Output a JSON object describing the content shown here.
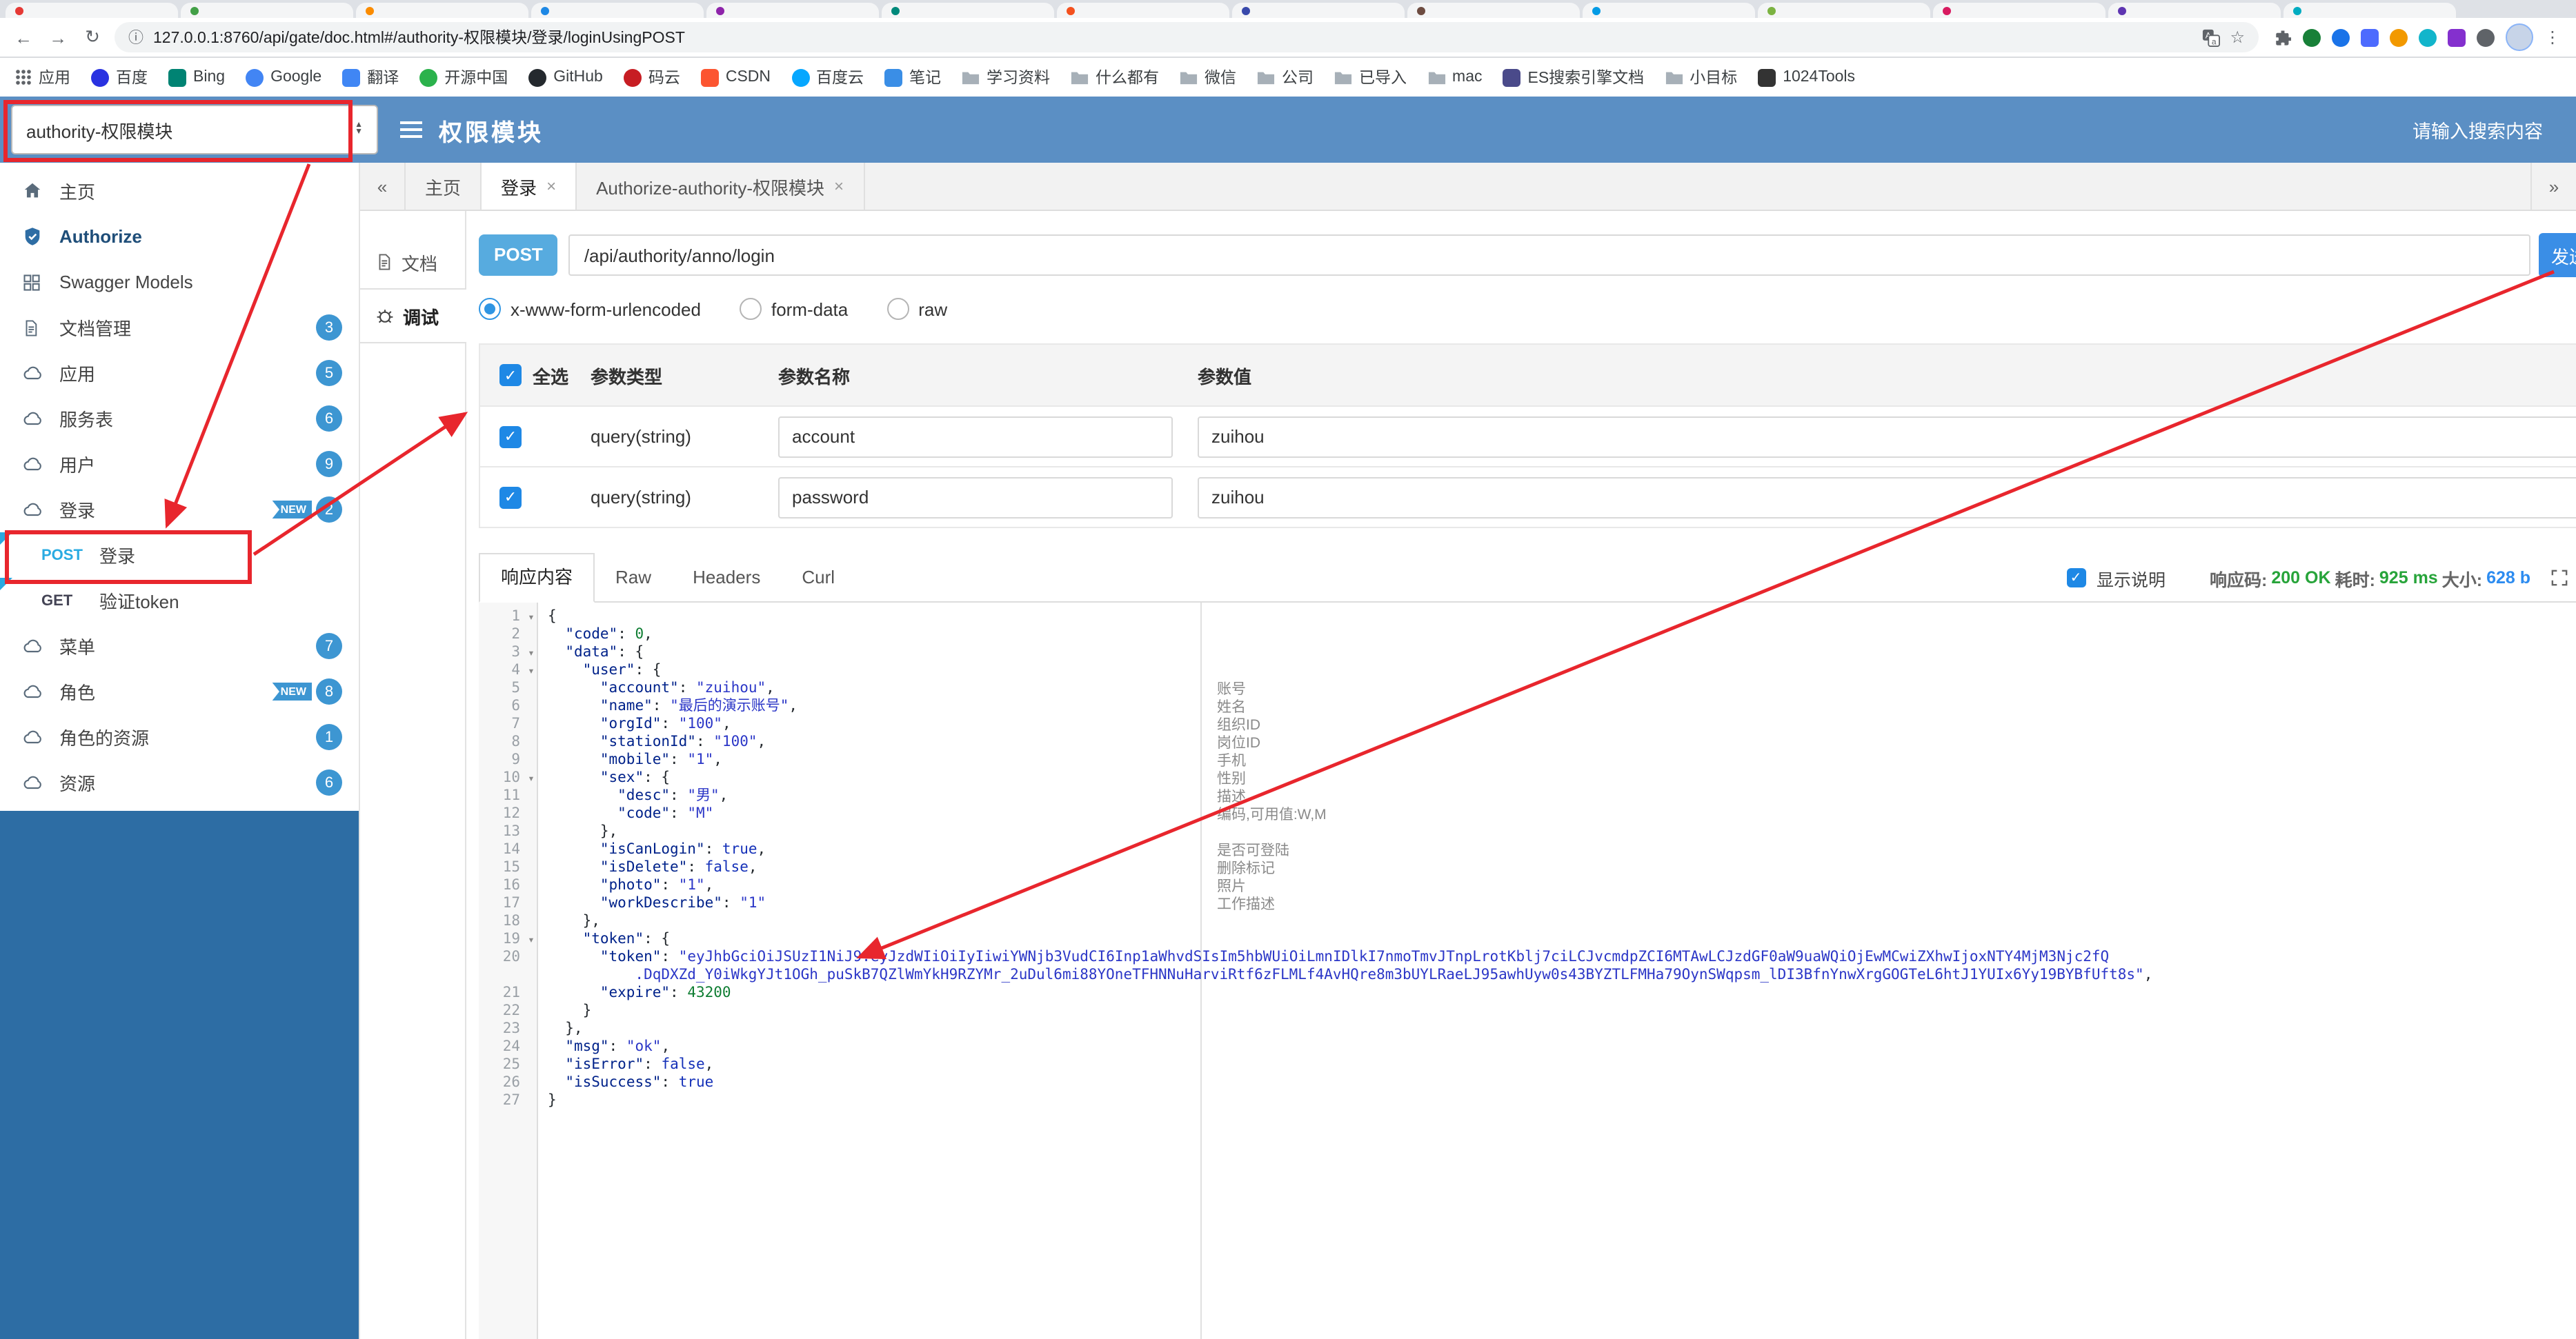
{
  "browser": {
    "url": "127.0.0.1:8760/api/gate/doc.html#/authority-权限模块/登录/loginUsingPOST",
    "bookmarks": [
      {
        "label": "应用",
        "icon": "grid"
      },
      {
        "label": "百度",
        "icon": "dot",
        "color": "#2932e1"
      },
      {
        "label": "Bing",
        "icon": "square",
        "color": "#008373"
      },
      {
        "label": "Google",
        "icon": "dot",
        "color": "#4285f4"
      },
      {
        "label": "翻译",
        "icon": "square",
        "color": "#4086f4"
      },
      {
        "label": "开源中国",
        "icon": "dot",
        "color": "#2bb24c"
      },
      {
        "label": "GitHub",
        "icon": "dot",
        "color": "#24292e"
      },
      {
        "label": "码云",
        "icon": "dot",
        "color": "#c71d23"
      },
      {
        "label": "CSDN",
        "icon": "square",
        "color": "#fc5531"
      },
      {
        "label": "百度云",
        "icon": "dot",
        "color": "#06a7ff"
      },
      {
        "label": "笔记",
        "icon": "square",
        "color": "#3a8ee6"
      },
      {
        "label": "学习资料",
        "icon": "folder"
      },
      {
        "label": "什么都有",
        "icon": "folder"
      },
      {
        "label": "微信",
        "icon": "folder"
      },
      {
        "label": "公司",
        "icon": "folder"
      },
      {
        "label": "已导入",
        "icon": "folder"
      },
      {
        "label": "mac",
        "icon": "folder"
      },
      {
        "label": "ES搜索引擎文档",
        "icon": "square",
        "color": "#4a4a8a"
      },
      {
        "label": "小目标",
        "icon": "folder"
      },
      {
        "label": "1024Tools",
        "icon": "square",
        "color": "#333333"
      }
    ]
  },
  "header": {
    "module_select": "authority-权限模块",
    "title": "权限模块",
    "search_placeholder": "请输入搜索内容"
  },
  "sidebar": {
    "new_label": "NEW",
    "items": [
      {
        "type": "nav",
        "label": "主页",
        "icon": "home"
      },
      {
        "type": "nav",
        "label": "Authorize",
        "icon": "shield"
      },
      {
        "type": "nav",
        "label": "Swagger Models",
        "icon": "models"
      },
      {
        "type": "nav",
        "label": "文档管理",
        "icon": "file",
        "badge": "3"
      },
      {
        "type": "nav",
        "label": "应用",
        "icon": "cloud",
        "badge": "5"
      },
      {
        "type": "nav",
        "label": "服务表",
        "icon": "cloud",
        "badge": "6"
      },
      {
        "type": "nav",
        "label": "用户",
        "icon": "cloud",
        "badge": "9"
      },
      {
        "type": "nav",
        "label": "登录",
        "icon": "cloud",
        "badge": "2",
        "new": true
      },
      {
        "type": "api",
        "method": "POST",
        "label": "登录"
      },
      {
        "type": "api",
        "method": "GET",
        "label": "验证token"
      },
      {
        "type": "nav",
        "label": "菜单",
        "icon": "cloud",
        "badge": "7"
      },
      {
        "type": "nav",
        "label": "角色",
        "icon": "cloud",
        "badge": "8",
        "new": true
      },
      {
        "type": "nav",
        "label": "角色的资源",
        "icon": "cloud",
        "badge": "1"
      },
      {
        "type": "nav",
        "label": "资源",
        "icon": "cloud",
        "badge": "6"
      }
    ]
  },
  "tabs": [
    {
      "label": "主页",
      "closable": false,
      "active": false
    },
    {
      "label": "登录",
      "closable": true,
      "active": true
    },
    {
      "label": "Authorize-authority-权限模块",
      "closable": true,
      "active": false
    }
  ],
  "panel": {
    "doc": "文档",
    "debug": "调试"
  },
  "endpoint": {
    "method": "POST",
    "path": "/api/authority/anno/login",
    "send_label": "发送"
  },
  "request": {
    "content_types": [
      "x-www-form-urlencoded",
      "form-data",
      "raw"
    ],
    "selected": "x-www-form-urlencoded",
    "table": {
      "headers": [
        "全选",
        "参数类型",
        "参数名称",
        "参数值"
      ],
      "rows": [
        {
          "checked": true,
          "type": "query(string)",
          "name": "account",
          "value": "zuihou"
        },
        {
          "checked": true,
          "type": "query(string)",
          "name": "password",
          "value": "zuihou"
        }
      ]
    }
  },
  "response": {
    "tabs": [
      "响应内容",
      "Raw",
      "Headers",
      "Curl"
    ],
    "active_tab": "响应内容",
    "desc_label": "显示说明",
    "desc_checked": true,
    "code_label": "响应码:",
    "code_value": "200 OK",
    "time_label": "耗时:",
    "time_value": "925 ms",
    "size_label": "大小:",
    "size_value": "628 b"
  },
  "code": {
    "lines": [
      {
        "n": 1,
        "fold": true,
        "seg": [
          [
            "pun",
            "{"
          ]
        ]
      },
      {
        "n": 2,
        "seg": [
          [
            "pun",
            "  "
          ],
          [
            "key",
            "\"code\""
          ],
          [
            "pun",
            ": "
          ],
          [
            "num",
            "0"
          ],
          [
            "pun",
            ","
          ]
        ]
      },
      {
        "n": 3,
        "fold": true,
        "seg": [
          [
            "pun",
            "  "
          ],
          [
            "key",
            "\"data\""
          ],
          [
            "pun",
            ": {"
          ]
        ]
      },
      {
        "n": 4,
        "fold": true,
        "seg": [
          [
            "pun",
            "    "
          ],
          [
            "key",
            "\"user\""
          ],
          [
            "pun",
            ": {"
          ]
        ]
      },
      {
        "n": 5,
        "ann": "账号",
        "seg": [
          [
            "pun",
            "      "
          ],
          [
            "key",
            "\"account\""
          ],
          [
            "pun",
            ": "
          ],
          [
            "str",
            "\"zuihou\""
          ],
          [
            "pun",
            ","
          ]
        ]
      },
      {
        "n": 6,
        "ann": "姓名",
        "seg": [
          [
            "pun",
            "      "
          ],
          [
            "key",
            "\"name\""
          ],
          [
            "pun",
            ": "
          ],
          [
            "str",
            "\"最后的演示账号\""
          ],
          [
            "pun",
            ","
          ]
        ]
      },
      {
        "n": 7,
        "ann": "组织ID",
        "seg": [
          [
            "pun",
            "      "
          ],
          [
            "key",
            "\"orgId\""
          ],
          [
            "pun",
            ": "
          ],
          [
            "str",
            "\"100\""
          ],
          [
            "pun",
            ","
          ]
        ]
      },
      {
        "n": 8,
        "ann": "岗位ID",
        "seg": [
          [
            "pun",
            "      "
          ],
          [
            "key",
            "\"stationId\""
          ],
          [
            "pun",
            ": "
          ],
          [
            "str",
            "\"100\""
          ],
          [
            "pun",
            ","
          ]
        ]
      },
      {
        "n": 9,
        "ann": "手机",
        "seg": [
          [
            "pun",
            "      "
          ],
          [
            "key",
            "\"mobile\""
          ],
          [
            "pun",
            ": "
          ],
          [
            "str",
            "\"1\""
          ],
          [
            "pun",
            ","
          ]
        ]
      },
      {
        "n": 10,
        "fold": true,
        "ann": "性别",
        "seg": [
          [
            "pun",
            "      "
          ],
          [
            "key",
            "\"sex\""
          ],
          [
            "pun",
            ": {"
          ]
        ]
      },
      {
        "n": 11,
        "ann": "描述",
        "seg": [
          [
            "pun",
            "        "
          ],
          [
            "key",
            "\"desc\""
          ],
          [
            "pun",
            ": "
          ],
          [
            "str",
            "\"男\""
          ],
          [
            "pun",
            ","
          ]
        ]
      },
      {
        "n": 12,
        "ann": "编码,可用值:W,M",
        "seg": [
          [
            "pun",
            "        "
          ],
          [
            "key",
            "\"code\""
          ],
          [
            "pun",
            ": "
          ],
          [
            "str",
            "\"M\""
          ]
        ]
      },
      {
        "n": 13,
        "seg": [
          [
            "pun",
            "      },"
          ]
        ]
      },
      {
        "n": 14,
        "ann": "是否可登陆",
        "seg": [
          [
            "pun",
            "      "
          ],
          [
            "key",
            "\"isCanLogin\""
          ],
          [
            "pun",
            ": "
          ],
          [
            "bool",
            "true"
          ],
          [
            "pun",
            ","
          ]
        ]
      },
      {
        "n": 15,
        "ann": "删除标记",
        "seg": [
          [
            "pun",
            "      "
          ],
          [
            "key",
            "\"isDelete\""
          ],
          [
            "pun",
            ": "
          ],
          [
            "bool",
            "false"
          ],
          [
            "pun",
            ","
          ]
        ]
      },
      {
        "n": 16,
        "ann": "照片",
        "seg": [
          [
            "pun",
            "      "
          ],
          [
            "key",
            "\"photo\""
          ],
          [
            "pun",
            ": "
          ],
          [
            "str",
            "\"1\""
          ],
          [
            "pun",
            ","
          ]
        ]
      },
      {
        "n": 17,
        "ann": "工作描述",
        "seg": [
          [
            "pun",
            "      "
          ],
          [
            "key",
            "\"workDescribe\""
          ],
          [
            "pun",
            ": "
          ],
          [
            "str",
            "\"1\""
          ]
        ]
      },
      {
        "n": 18,
        "seg": [
          [
            "pun",
            "    },"
          ]
        ]
      },
      {
        "n": 19,
        "fold": true,
        "seg": [
          [
            "pun",
            "    "
          ],
          [
            "key",
            "\"token\""
          ],
          [
            "pun",
            ": {"
          ]
        ]
      },
      {
        "n": 20,
        "seg": [
          [
            "pun",
            "      "
          ],
          [
            "key",
            "\"token\""
          ],
          [
            "pun",
            ": "
          ],
          [
            "str",
            "\"eyJhbGciOiJSUzI1NiJ9.eyJzdWIiOiIyIiwiYWNjb3VudCI6Inp1aWhvdSIsIm5hbWUiOiLmnIDlkI7nmoTmvJTnpLrotKblj7ciLCJvcmdpZCI6MTAwLCJzdGF0aW9uaWQiOjEwMCwiZXhwIjoxNTY4MjM3Njc2fQ\n          .DqDXZd_Y0iWkgYJt1OGh_puSkB7QZlWmYkH9RZYMr_2uDul6mi88YOneTFHNNuHarviRtf6zFLMLf4AvHQre8m3bUYLRaeLJ95awhUyw0s43BYZTLFMHa79OynSWqpsm_lDI3BfnYnwXrgGOGTeL6htJ1YUIx6Yy19BYBfUft8s\""
          ],
          [
            "pun",
            ","
          ]
        ]
      },
      {
        "n": 21,
        "seg": [
          [
            "pun",
            "      "
          ],
          [
            "key",
            "\"expire\""
          ],
          [
            "pun",
            ": "
          ],
          [
            "num",
            "43200"
          ]
        ]
      },
      {
        "n": 22,
        "seg": [
          [
            "pun",
            "    }"
          ]
        ]
      },
      {
        "n": 23,
        "seg": [
          [
            "pun",
            "  },"
          ]
        ]
      },
      {
        "n": 24,
        "seg": [
          [
            "pun",
            "  "
          ],
          [
            "key",
            "\"msg\""
          ],
          [
            "pun",
            ": "
          ],
          [
            "str",
            "\"ok\""
          ],
          [
            "pun",
            ","
          ]
        ]
      },
      {
        "n": 25,
        "seg": [
          [
            "pun",
            "  "
          ],
          [
            "key",
            "\"isError\""
          ],
          [
            "pun",
            ": "
          ],
          [
            "bool",
            "false"
          ],
          [
            "pun",
            ","
          ]
        ]
      },
      {
        "n": 26,
        "seg": [
          [
            "pun",
            "  "
          ],
          [
            "key",
            "\"isSuccess\""
          ],
          [
            "pun",
            ": "
          ],
          [
            "bool",
            "true"
          ]
        ]
      },
      {
        "n": 27,
        "seg": [
          [
            "pun",
            "}"
          ]
        ]
      }
    ]
  },
  "colors": {
    "header_blue": "#5b8fc4",
    "sidebar_blue": "#2d6da4",
    "accent_blue": "#1e88e5",
    "post_badge_blue": "#57abdf",
    "status_green": "#27a43a",
    "size_blue": "#2d8cf0",
    "annotation_red": "#e8262d"
  }
}
